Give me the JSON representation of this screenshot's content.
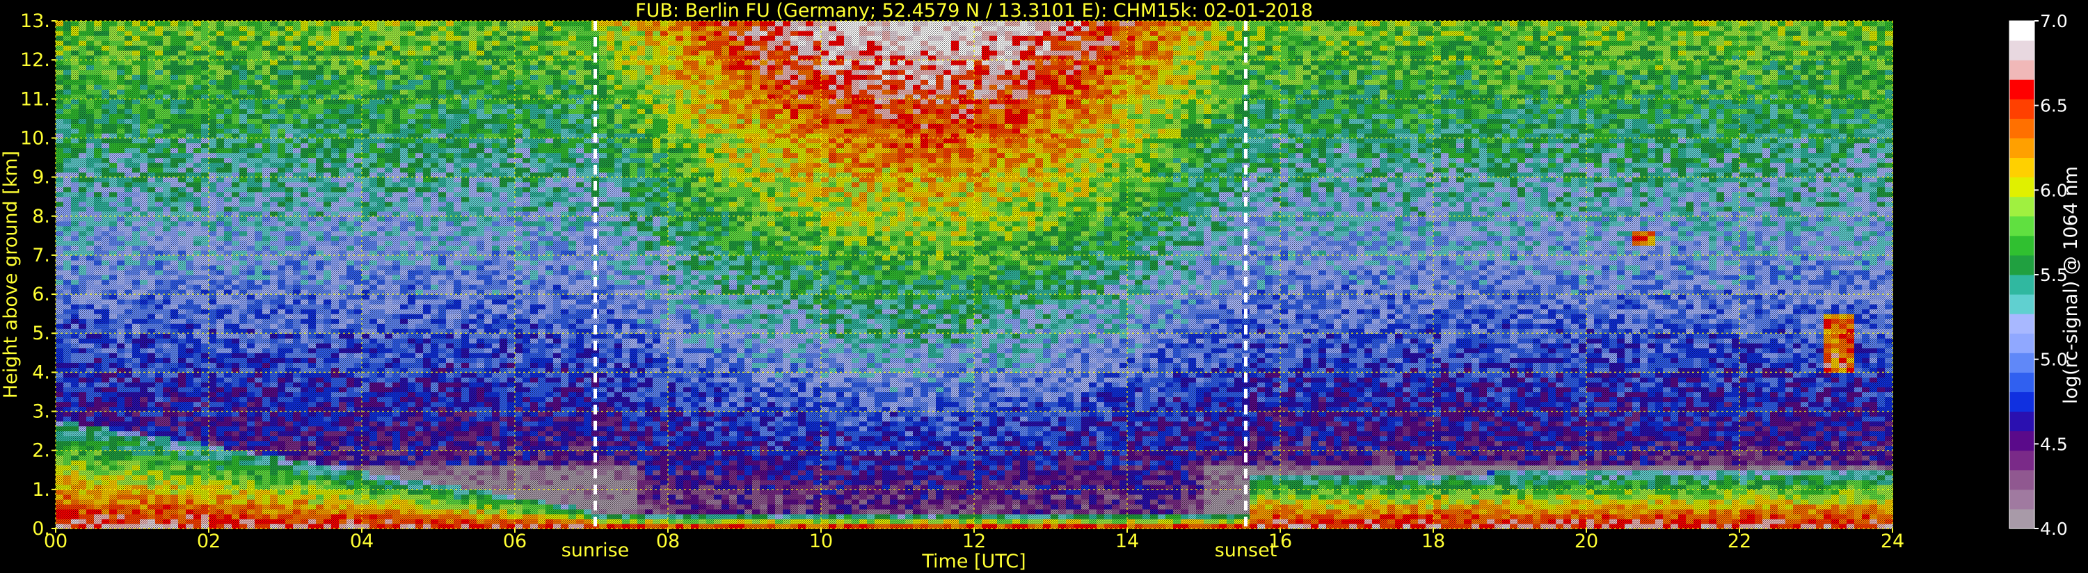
{
  "chart_data": {
    "type": "heatmap",
    "title": "FUB: Berlin FU (Germany; 52.4579 N / 13.3101 E):    CHM15k: 02-01-2018",
    "xlabel": "Time [UTC]",
    "ylabel": "Height above ground [km]",
    "xlim": [
      0,
      24
    ],
    "ylim": [
      0,
      13
    ],
    "x_ticks": [
      0,
      2,
      4,
      6,
      8,
      10,
      12,
      14,
      16,
      18,
      20,
      22,
      24
    ],
    "x_tick_labels": [
      "00",
      "02",
      "04",
      "06",
      "08",
      "10",
      "12",
      "14",
      "16",
      "18",
      "20",
      "22",
      "24"
    ],
    "y_ticks": [
      0,
      1,
      2,
      3,
      4,
      5,
      6,
      7,
      8,
      9,
      10,
      11,
      12,
      13
    ],
    "y_tick_labels": [
      "0.",
      "1.",
      "2.",
      "3.",
      "4.",
      "5.",
      "6.",
      "7.",
      "8.",
      "9.",
      "10.",
      "11.",
      "12.",
      "13."
    ],
    "grid": true,
    "grid_color": "#ffff00",
    "background_color": "#000000",
    "label_color": "#ffff33",
    "markers": [
      {
        "label": "sunrise",
        "x": 7.05
      },
      {
        "label": "sunset",
        "x": 15.55
      }
    ],
    "colorbar": {
      "label": "log(rc-signal) @ 1064 nm",
      "range": [
        4.0,
        7.0
      ],
      "ticks": [
        4.0,
        4.5,
        5.0,
        5.5,
        6.0,
        6.5,
        7.0
      ],
      "tick_labels": [
        "4.0",
        "4.5",
        "5.0",
        "5.5",
        "6.0",
        "6.5",
        "7.0"
      ],
      "colors": [
        "#a89aa8",
        "#a07aa0",
        "#905890",
        "#7a2a88",
        "#5a0a8a",
        "#2a10b0",
        "#1030e0",
        "#3060f0",
        "#6088f8",
        "#90a8ff",
        "#a8b8ff",
        "#60d0d0",
        "#30b8a0",
        "#20a040",
        "#30c030",
        "#60e040",
        "#a0f040",
        "#e0f000",
        "#ffd000",
        "#ffa000",
        "#ff7000",
        "#ff4000",
        "#ff0000",
        "#f0b8b8",
        "#e8d8e0",
        "#ffffff"
      ]
    },
    "features": [
      {
        "name": "boundary-layer-morning",
        "x": [
          0.0,
          7.0
        ],
        "top_km": [
          2.8,
          0.5
        ]
      },
      {
        "name": "boundary-layer-evening",
        "x": [
          15.6,
          24.0
        ],
        "top_km": [
          1.4,
          1.5
        ]
      },
      {
        "name": "cloud-2320",
        "x": [
          23.1,
          23.5
        ],
        "height_km": [
          4.0,
          5.5
        ]
      },
      {
        "name": "cloud-2040",
        "x": [
          20.6,
          20.9
        ],
        "height_km": [
          7.2,
          7.6
        ]
      }
    ]
  }
}
